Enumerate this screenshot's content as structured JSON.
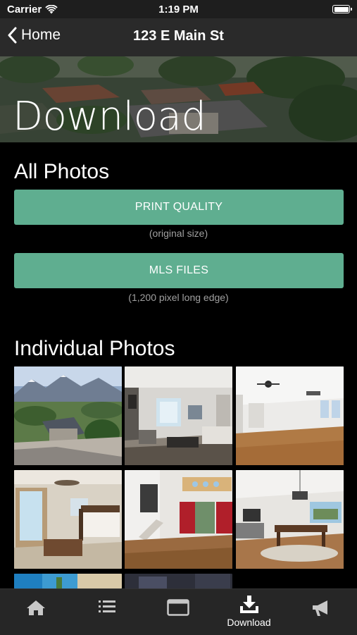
{
  "status_bar": {
    "carrier": "Carrier",
    "time": "1:19 PM"
  },
  "nav": {
    "back_label": "Home",
    "title": "123 E Main St"
  },
  "hero": {
    "title": "Download"
  },
  "all_photos": {
    "heading": "All Photos",
    "print_button": "PRINT QUALITY",
    "print_caption": "(original size)",
    "mls_button": "MLS FILES",
    "mls_caption": "(1,200 pixel long edge)"
  },
  "individual_photos": {
    "heading": "Individual Photos",
    "photos": [
      {
        "subject": "aerial-exterior"
      },
      {
        "subject": "living-room"
      },
      {
        "subject": "open-great-room"
      },
      {
        "subject": "bedroom"
      },
      {
        "subject": "foyer-staircase"
      },
      {
        "subject": "dining-room"
      },
      {
        "subject": "partial-pool"
      },
      {
        "subject": "partial-room"
      }
    ]
  },
  "tab_bar": {
    "tabs": [
      {
        "icon": "home-icon",
        "label": ""
      },
      {
        "icon": "list-icon",
        "label": ""
      },
      {
        "icon": "browser-window-icon",
        "label": ""
      },
      {
        "icon": "download-icon",
        "label": "Download",
        "selected": true
      },
      {
        "icon": "megaphone-icon",
        "label": ""
      }
    ]
  },
  "colors": {
    "accent_button": "#5fae90",
    "background": "#000000",
    "bar": "#262626"
  }
}
